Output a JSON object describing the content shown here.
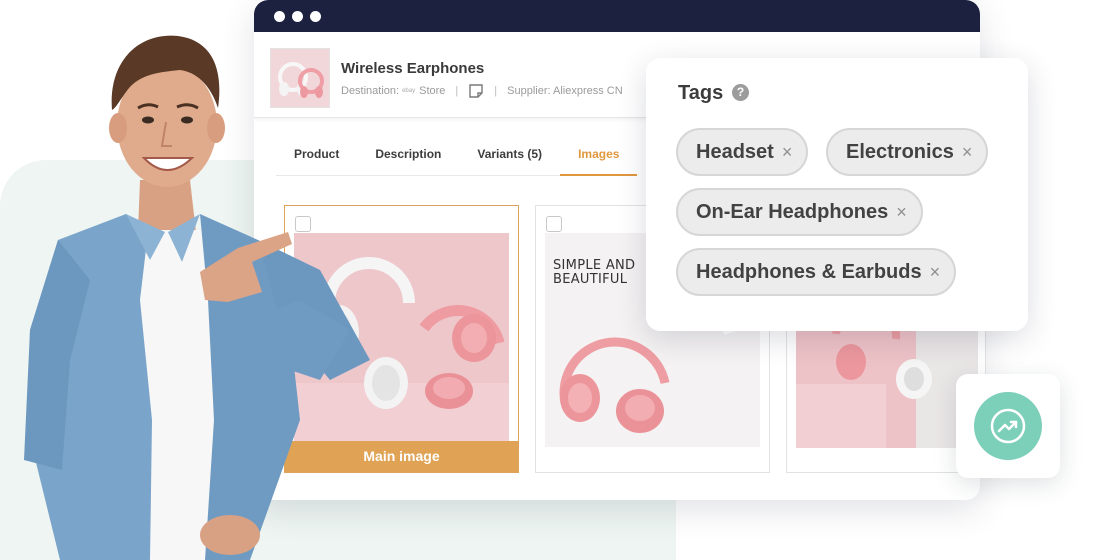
{
  "product": {
    "title": "Wireless Earphones",
    "destination_label": "Destination:",
    "destination_marketplace": "ebay",
    "destination_value": "Store",
    "supplier": "Supplier: Aliexpress CN"
  },
  "tabs": [
    {
      "label": "Product"
    },
    {
      "label": "Description"
    },
    {
      "label": "Variants (5)"
    },
    {
      "label": "Images",
      "active": true
    }
  ],
  "images": {
    "main_label": "Main image",
    "card2_text_line1": "SIMPLE AND",
    "card2_text_line2": "BEAUTIFUL"
  },
  "tags": {
    "title": "Tags",
    "help_icon": "question-mark-icon",
    "items": [
      {
        "label": "Headset"
      },
      {
        "label": "Electronics"
      },
      {
        "label": "On-Ear Headphones"
      },
      {
        "label": "Headphones & Earbuds"
      }
    ],
    "remove_glyph": "×"
  },
  "colors": {
    "titlebar": "#1c2140",
    "accent_orange": "#e0983f",
    "trend_green": "#7ccfb9",
    "background_tint": "#eef5f2"
  },
  "icons": {
    "trend": "trending-up-icon",
    "note": "note-icon"
  }
}
